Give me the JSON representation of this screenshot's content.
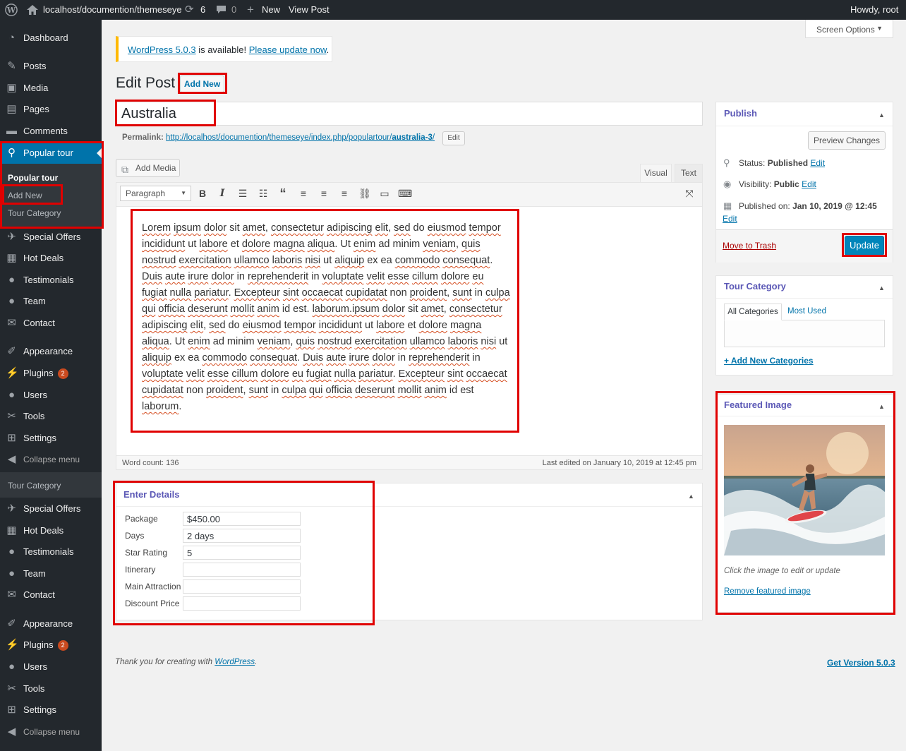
{
  "adminbar": {
    "site_url": "localhost/documention/themeseye",
    "updates_count": "6",
    "comments_count": "0",
    "new_label": "New",
    "view_post_label": "View Post",
    "howdy": "Howdy, root"
  },
  "sidebar": {
    "top_items": [
      {
        "label": "Dashboard",
        "icon": "dashboard-icon"
      },
      {
        "label": "Posts",
        "icon": "pin-icon"
      },
      {
        "label": "Media",
        "icon": "media-icon"
      },
      {
        "label": "Pages",
        "icon": "pages-icon"
      },
      {
        "label": "Comments",
        "icon": "comments-icon"
      },
      {
        "label": "Popular tour",
        "icon": "location-icon"
      }
    ],
    "popular_tour_submenu": [
      "Popular tour",
      "Add New",
      "Tour Category"
    ],
    "items_a": [
      {
        "label": "Special Offers"
      },
      {
        "label": "Hot Deals"
      },
      {
        "label": "Testimonials"
      },
      {
        "label": "Team"
      },
      {
        "label": "Contact"
      },
      {
        "label": "Appearance"
      },
      {
        "label": "Plugins",
        "badge": "2"
      },
      {
        "label": "Users"
      },
      {
        "label": "Tools"
      },
      {
        "label": "Settings"
      },
      {
        "label": "Collapse menu"
      }
    ],
    "tour_category": "Tour Category",
    "items_b": [
      {
        "label": "Special Offers"
      },
      {
        "label": "Hot Deals"
      },
      {
        "label": "Testimonials"
      },
      {
        "label": "Team"
      },
      {
        "label": "Contact"
      },
      {
        "label": "Appearance"
      },
      {
        "label": "Plugins",
        "badge": "2"
      },
      {
        "label": "Users"
      },
      {
        "label": "Tools"
      },
      {
        "label": "Settings"
      },
      {
        "label": "Collapse menu"
      }
    ]
  },
  "screen_options": "Screen Options",
  "notice": {
    "link": "WordPress 5.0.3",
    "text": " is available! ",
    "update_link": "Please update now",
    "end": "."
  },
  "header": {
    "title": "Edit Post",
    "add_new": "Add New"
  },
  "post": {
    "title": "Australia",
    "permalink_label": "Permalink:",
    "permalink_base": "http://localhost/documention/themeseye/index.php/populartour/",
    "permalink_slug": "australia-3",
    "permalink_end": "/",
    "edit_btn": "Edit"
  },
  "editor": {
    "add_media": "Add Media",
    "tab_visual": "Visual",
    "tab_text": "Text",
    "format_select": "Paragraph",
    "word_count": "Word count: 136",
    "last_edited": "Last edited on January 10, 2019 at 12:45 pm"
  },
  "details": {
    "title": "Enter Details",
    "fields": [
      {
        "label": "Package",
        "value": "$450.00"
      },
      {
        "label": "Days",
        "value": "2 days"
      },
      {
        "label": "Star Rating",
        "value": "5"
      },
      {
        "label": "Itinerary",
        "value": ""
      },
      {
        "label": "Main Attraction",
        "value": ""
      },
      {
        "label": "Discount Price",
        "value": ""
      }
    ]
  },
  "publish": {
    "title": "Publish",
    "preview": "Preview Changes",
    "status_label": "Status: ",
    "status_value": "Published",
    "visibility_label": "Visibility: ",
    "visibility_value": "Public",
    "published_label": "Published on: ",
    "published_value": "Jan 10, 2019 @ 12:45",
    "edit": "Edit",
    "trash": "Move to Trash",
    "update": "Update"
  },
  "tour_category": {
    "title": "Tour Category",
    "tab_all": "All Categories",
    "tab_used": "Most Used",
    "add_new": "+ Add New Categories"
  },
  "featured": {
    "title": "Featured Image",
    "hint": "Click the image to edit or update",
    "remove": "Remove featured image"
  },
  "footer": {
    "thanks": "Thank you for creating with ",
    "wp": "WordPress",
    "dot": ".",
    "version": "Get Version 5.0.3"
  },
  "colors": {
    "accent": "#0073aa",
    "highlight": "#e00000",
    "sidebar": "#23282d",
    "active_menu": "#0073aa"
  }
}
